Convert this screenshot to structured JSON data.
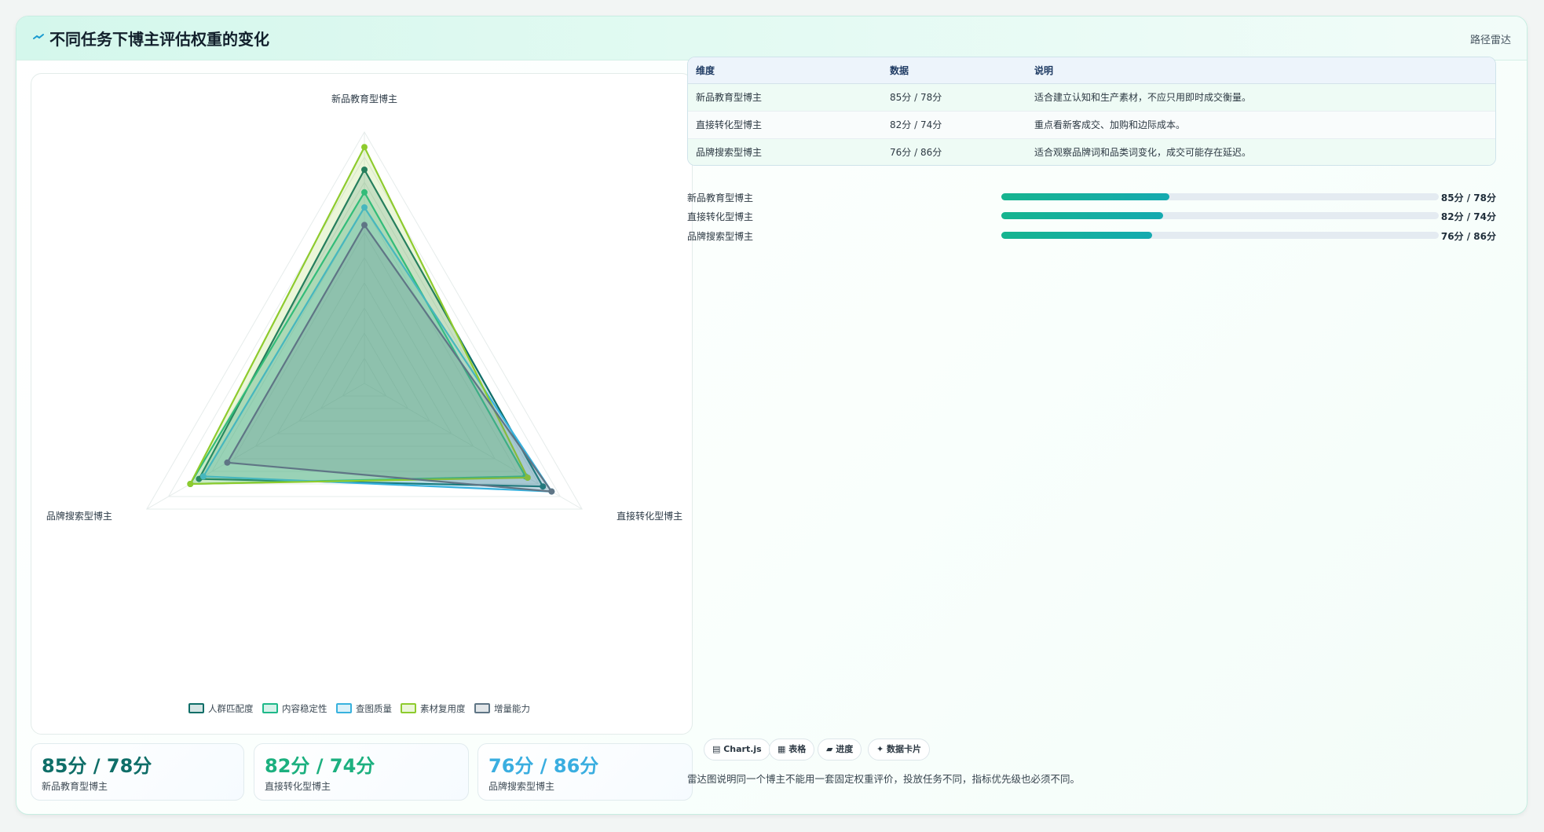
{
  "header": {
    "title": "不同任务下博主评估权重的变化",
    "right_label": "路径雷达"
  },
  "chart_data": {
    "type": "radar",
    "axes": [
      "新品教育型博主",
      "直接转化型博主",
      "品牌搜索型博主"
    ],
    "range": [
      0,
      100
    ],
    "grid": true,
    "legend_position": "bottom",
    "series": [
      {
        "name": "人群匹配度",
        "color": "#0f6e68",
        "values": [
          85,
          82,
          76
        ]
      },
      {
        "name": "内容稳定性",
        "color": "#1fb98a",
        "values": [
          76,
          74,
          80
        ]
      },
      {
        "name": "查图质量",
        "color": "#38b2de",
        "values": [
          70,
          86,
          74
        ]
      },
      {
        "name": "素材复用度",
        "color": "#8ecb2e",
        "values": [
          94,
          75,
          80
        ]
      },
      {
        "name": "增量能力",
        "color": "#5f7585",
        "values": [
          63,
          86,
          63
        ]
      }
    ]
  },
  "table": {
    "headers": [
      "维度",
      "数据",
      "说明"
    ],
    "rows": [
      {
        "name": "新品教育型博主",
        "data": "85分 / 78分",
        "desc": "适合建立认知和生产素材，不应只用即时成交衡量。"
      },
      {
        "name": "直接转化型博主",
        "data": "82分 / 74分",
        "desc": "重点看新客成交、加购和边际成本。"
      },
      {
        "name": "品牌搜索型博主",
        "data": "76分 / 86分",
        "desc": "适合观察品牌词和品类词变化，成交可能存在延迟。"
      }
    ]
  },
  "progress": [
    {
      "label": "新品教育型博主",
      "value": "85分 / 78分",
      "fraction": 0.385
    },
    {
      "label": "直接转化型博主",
      "value": "82分 / 74分",
      "fraction": 0.37
    },
    {
      "label": "品牌搜索型博主",
      "value": "76分 / 86分",
      "fraction": 0.345
    }
  ],
  "stats": [
    {
      "value": "85分 / 78分",
      "label": "新品教育型博主",
      "color": "#0f6e68"
    },
    {
      "value": "82分 / 74分",
      "label": "直接转化型博主",
      "color": "#1cb07f"
    },
    {
      "value": "76分 / 86分",
      "label": "品牌搜索型博主",
      "color": "#3aaee0"
    }
  ],
  "chips": [
    "▤ Chart.js",
    "▦ 表格",
    "▰ 进度",
    "✦ 数据卡片"
  ],
  "footer_note": "雷达图说明同一个博主不能用一套固定权重评价，投放任务不同，指标优先级也必须不同。"
}
